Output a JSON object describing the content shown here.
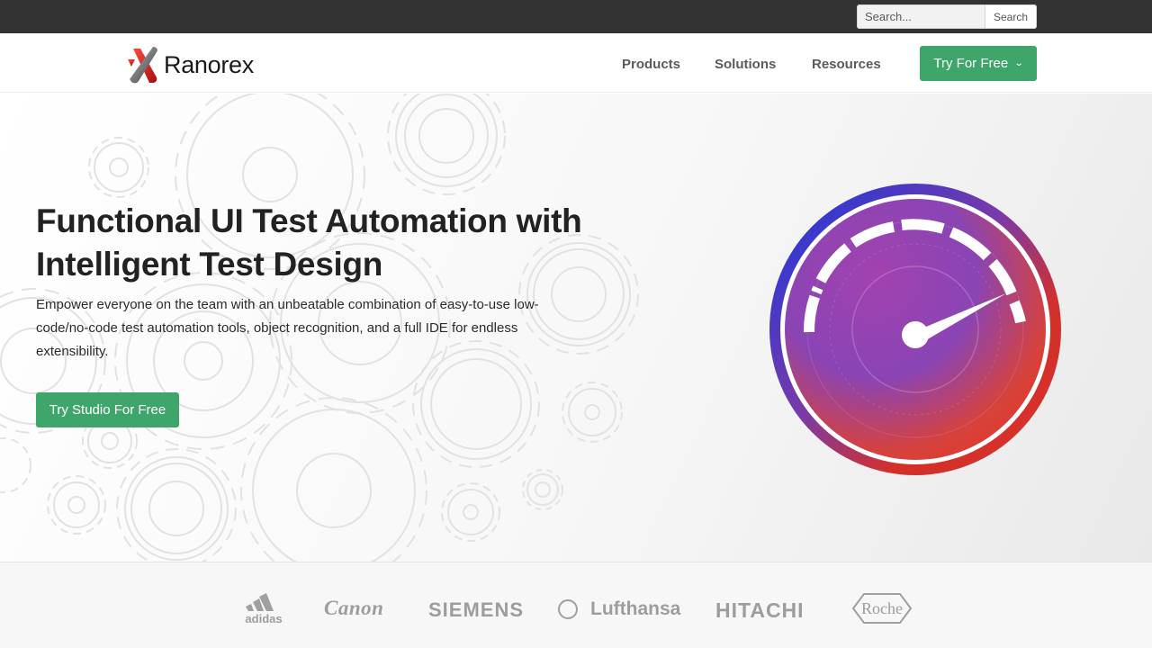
{
  "search": {
    "placeholder": "Search...",
    "button_label": "Search"
  },
  "brand": {
    "name": "Ranorex"
  },
  "nav": {
    "items": [
      {
        "label": "Products"
      },
      {
        "label": "Solutions"
      },
      {
        "label": "Resources"
      }
    ],
    "cta_label": "Try For Free"
  },
  "hero": {
    "title": "Functional UI Test Automation with Intelligent Test Design",
    "subtitle": "Empower everyone on the team with an unbeatable combination of easy-to-use low-code/no-code test automation tools, object recognition, and a full IDE for endless extensibility.",
    "cta_label": "Try Studio For Free"
  },
  "customer_logos": [
    "adidas",
    "Canon",
    "SIEMENS",
    "Lufthansa",
    "HITACHI",
    "Roche"
  ],
  "colors": {
    "accent_green": "#3fa66b",
    "topbar": "#333333",
    "gauge_blue": "#1f3fd6",
    "gauge_red": "#d8322a"
  }
}
